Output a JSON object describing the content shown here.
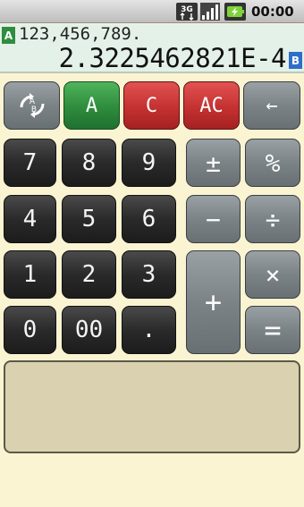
{
  "status_bar": {
    "time": "00:00",
    "icons": [
      "3g-icon",
      "signal-icon",
      "battery-icon"
    ]
  },
  "display": {
    "register_a_label": "A",
    "register_b_label": "B",
    "memo_value": "123,456,789.",
    "result_value": "2.3225462821E-4"
  },
  "keys": {
    "swap": "A⇄B",
    "a": "A",
    "c": "C",
    "ac": "AC",
    "backspace": "←",
    "n7": "7",
    "n8": "8",
    "n9": "9",
    "n4": "4",
    "n5": "5",
    "n6": "6",
    "n1": "1",
    "n2": "2",
    "n3": "3",
    "n0": "0",
    "n00": "00",
    "dot": ".",
    "plusminus": "±",
    "percent": "%",
    "minus": "−",
    "divide": "÷",
    "plus": "+",
    "multiply": "×",
    "equals": "="
  },
  "colors": {
    "background": "#fbf4d2",
    "display": "#e4f1e8",
    "number_key": "#2a2a2a",
    "operator_key": "#7b8387",
    "green_key": "#2e8c3c",
    "red_key": "#c43131",
    "tape": "#d9d1af"
  }
}
